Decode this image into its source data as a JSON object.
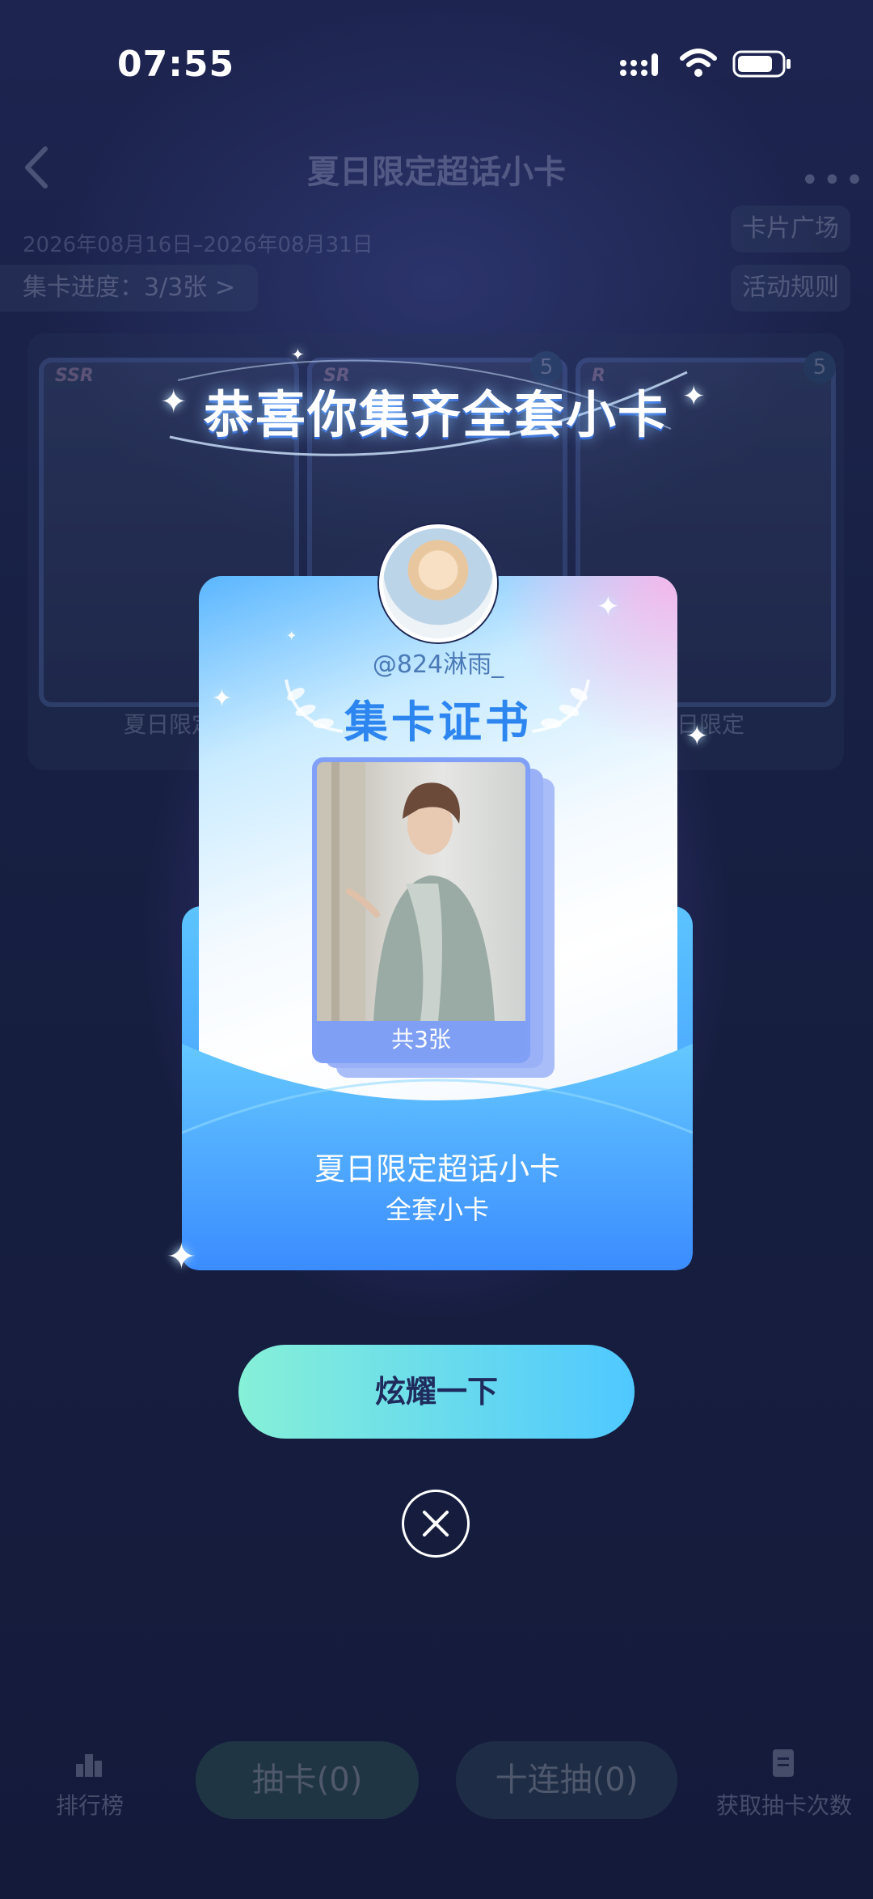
{
  "status_bar": {
    "time": "07:55"
  },
  "background_page": {
    "title": "夏日限定超话小卡",
    "date_range": "2026年08月16日–2026年08月31日",
    "progress": "集卡进度：3/3张 >",
    "card_square": "卡片广场",
    "activity_rules": "活动规则",
    "cards": [
      {
        "rarity": "SSR",
        "label": "夏日限定"
      },
      {
        "rarity": "SR",
        "count": "5"
      },
      {
        "rarity": "R",
        "count": "5",
        "label": "日限定"
      }
    ],
    "bottom_bar": {
      "rank_label": "排行榜",
      "draw_label": "抽卡(0)",
      "ten_draw_label": "十连抽(0)",
      "get_draws_label": "获取抽卡次数"
    }
  },
  "modal": {
    "headline": "恭喜你集齐全套小卡",
    "username": "@824淋雨_",
    "certificate_title": "集卡证书",
    "card_count": "共3张",
    "collection_name": "夏日限定超话小卡",
    "collection_sub": "全套小卡",
    "show_off_button": "炫耀一下"
  },
  "colors": {
    "background": "#151a3b",
    "certificate_blue": "#2d86f0",
    "envelope_blue": "#3b8dff",
    "button_gradient_start": "#86f0d8",
    "button_gradient_end": "#4fc8ff"
  },
  "icons": [
    "back-icon",
    "more-icon",
    "signal-icon",
    "wifi-icon",
    "battery-icon",
    "rank-icon",
    "get-draws-icon",
    "close-icon",
    "sparkle-icon"
  ]
}
